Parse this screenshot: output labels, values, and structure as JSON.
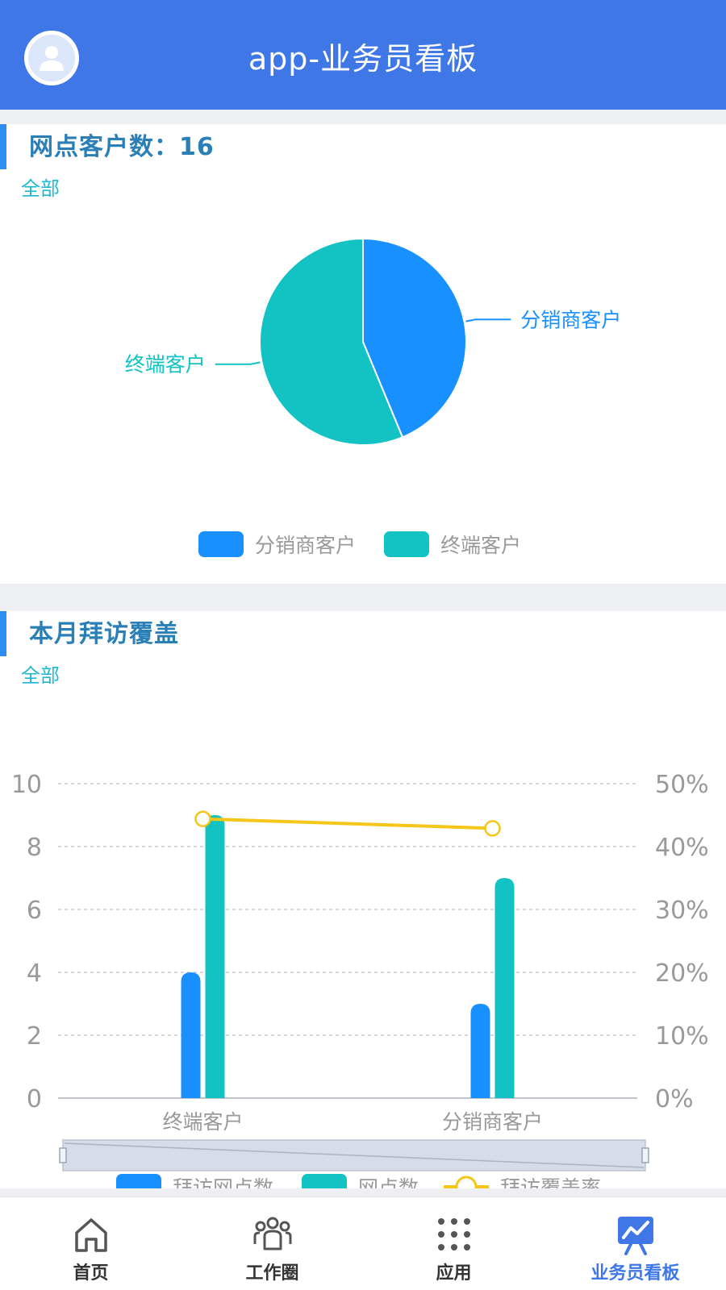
{
  "header": {
    "title": "app-业务员看板",
    "avatar_icon": "user-avatar-icon"
  },
  "card1": {
    "title": "网点客户数：16",
    "filter": "全部"
  },
  "card2": {
    "title": "本月拜访覆盖",
    "filter": "全部"
  },
  "colors": {
    "header": "#3f78e6",
    "blue": "#1890ff",
    "teal": "#13c2c2",
    "yellow": "#f5c518",
    "title": "#2a7fb6",
    "accent": "#2d8df0"
  },
  "chart_data": [
    {
      "type": "pie",
      "labels": [
        "分销商客户",
        "终端客户"
      ],
      "values": [
        7,
        9
      ],
      "legend": [
        "分销商客户",
        "终端客户"
      ],
      "legend_position": "bottom",
      "colors": [
        "#1890ff",
        "#13c2c2"
      ]
    },
    {
      "type": "bar",
      "categories": [
        "终端客户",
        "分销商客户"
      ],
      "series": [
        {
          "name": "拜访网点数",
          "type": "bar",
          "values": [
            4,
            3
          ],
          "color": "#1890ff"
        },
        {
          "name": "网点数",
          "type": "bar",
          "values": [
            9,
            7
          ],
          "color": "#13c2c2"
        },
        {
          "name": "拜访覆盖率",
          "type": "line",
          "axis": "right",
          "values": [
            44.4,
            42.9
          ],
          "color": "#f5c518"
        }
      ],
      "ylim": [
        0,
        10
      ],
      "yticks": [
        "0",
        "2",
        "4",
        "6",
        "8",
        "10"
      ],
      "y2lim": [
        0,
        50
      ],
      "y2ticks": [
        "0%",
        "10%",
        "20%",
        "30%",
        "40%",
        "50%"
      ],
      "grid": true,
      "legend_position": "bottom",
      "data_zoom": true
    }
  ],
  "tabbar": {
    "items": [
      {
        "label": "首页",
        "icon": "home-icon",
        "active": false
      },
      {
        "label": "工作圈",
        "icon": "people-group-icon",
        "active": false
      },
      {
        "label": "应用",
        "icon": "app-grid-icon",
        "active": false
      },
      {
        "label": "业务员看板",
        "icon": "dashboard-chart-icon",
        "active": true
      }
    ]
  }
}
